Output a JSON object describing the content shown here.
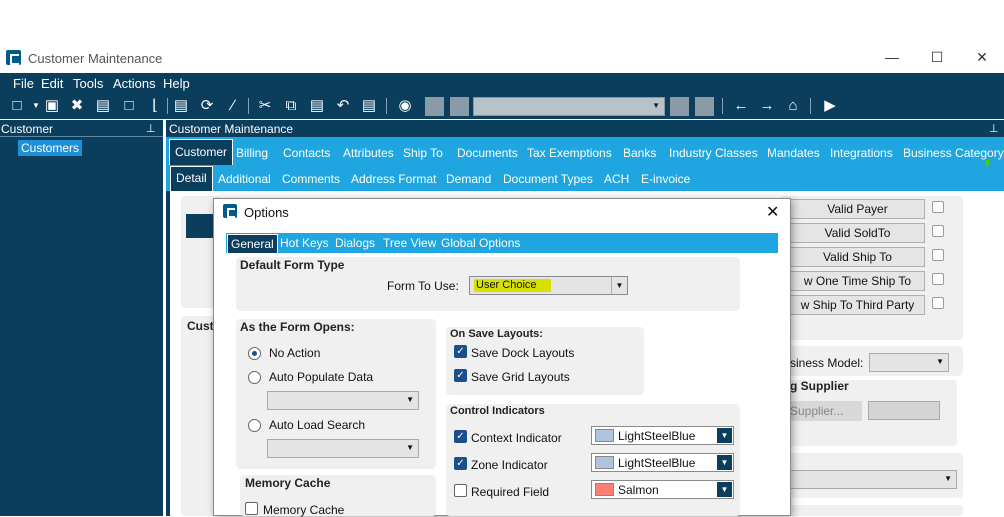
{
  "window": {
    "title": "Customer Maintenance"
  },
  "menu": [
    "File",
    "Edit",
    "Tools",
    "Actions",
    "Help"
  ],
  "left_pane": {
    "title": "Customer",
    "items": [
      "Customers"
    ]
  },
  "main_pane": {
    "title": "Customer Maintenance"
  },
  "tabs_primary": {
    "active": "Customer",
    "items": [
      "Billing",
      "Contacts",
      "Attributes",
      "Ship To",
      "Documents",
      "Tax Exemptions",
      "Banks",
      "Industry Classes",
      "Mandates",
      "Integrations",
      "Business Category"
    ]
  },
  "tabs_secondary": {
    "active": "Detail",
    "items": [
      "Additional",
      "Comments",
      "Address Format",
      "Demand",
      "Document Types",
      "ACH",
      "E-invoice"
    ]
  },
  "background": {
    "right_buttons": [
      "Valid Payer",
      "Valid SoldTo",
      "Valid Ship To",
      "w One Time Ship To",
      "w Ship To Third Party"
    ],
    "cust_label": "Cust",
    "business_model_label": "siness Model:",
    "supplier_title": "g Supplier",
    "supplier_button": "Supplier..."
  },
  "dialog": {
    "title": "Options",
    "tabs": {
      "active": "General",
      "items": [
        "Hot Keys",
        "Dialogs",
        "Tree View",
        "Global Options"
      ]
    },
    "default_form_type": {
      "title": "Default Form Type",
      "label": "Form To Use:",
      "value": "User Choice"
    },
    "form_opens": {
      "title": "As the Form Opens:",
      "options": [
        "No Action",
        "Auto Populate Data",
        "Auto Load Search"
      ],
      "selected": "No Action"
    },
    "save_layouts": {
      "title": "On Save Layouts:",
      "items": [
        {
          "label": "Save Dock Layouts",
          "checked": true
        },
        {
          "label": "Save Grid Layouts",
          "checked": true
        }
      ]
    },
    "control_indicators": {
      "title": "Control Indicators",
      "items": [
        {
          "label": "Context Indicator",
          "checked": true,
          "color_name": "LightSteelBlue",
          "color": "#b0c4de"
        },
        {
          "label": "Zone Indicator",
          "checked": true,
          "color_name": "LightSteelBlue",
          "color": "#b0c4de"
        },
        {
          "label": "Required Field",
          "checked": false,
          "color_name": "Salmon",
          "color": "#fa8072"
        }
      ]
    },
    "memory_cache": {
      "title": "Memory Cache",
      "label": "Memory Cache",
      "checked": false
    }
  },
  "colors": {
    "navy": "#0b3d5c",
    "accent": "#1fa6e0",
    "highlight": "#d8e000"
  }
}
